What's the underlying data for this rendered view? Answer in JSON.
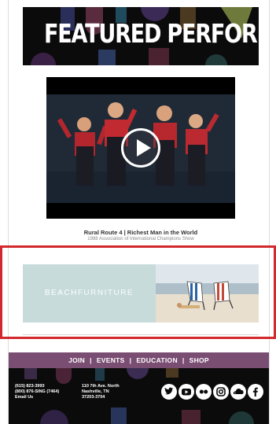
{
  "featured": {
    "title": "FEATURED PERFORMANCE"
  },
  "video": {
    "title": "Rural Route 4 | Richest Man in the World",
    "subtitle": "1988 Association of International Champions Show",
    "play_icon": "play-icon"
  },
  "ad": {
    "brand_part1": "BEACH",
    "brand_part2": "FURNITURE",
    "highlight_color": "#d2282e"
  },
  "footer": {
    "nav": [
      {
        "label": "JOIN"
      },
      {
        "label": "EVENTS"
      },
      {
        "label": "EDUCATION"
      },
      {
        "label": "SHOP"
      }
    ],
    "separator": "|",
    "phone1": "(615) 823-3993",
    "phone2": "(800) 876-SING (7464)",
    "email": "Email Us",
    "address1": "110 7th Ave. North",
    "address2": "Nashville, TN",
    "address3": "37203-3704",
    "social": [
      "twitter-icon",
      "youtube-icon",
      "flickr-icon",
      "instagram-icon",
      "soundcloud-icon",
      "facebook-icon"
    ],
    "nav_color": "#7a4d73"
  }
}
